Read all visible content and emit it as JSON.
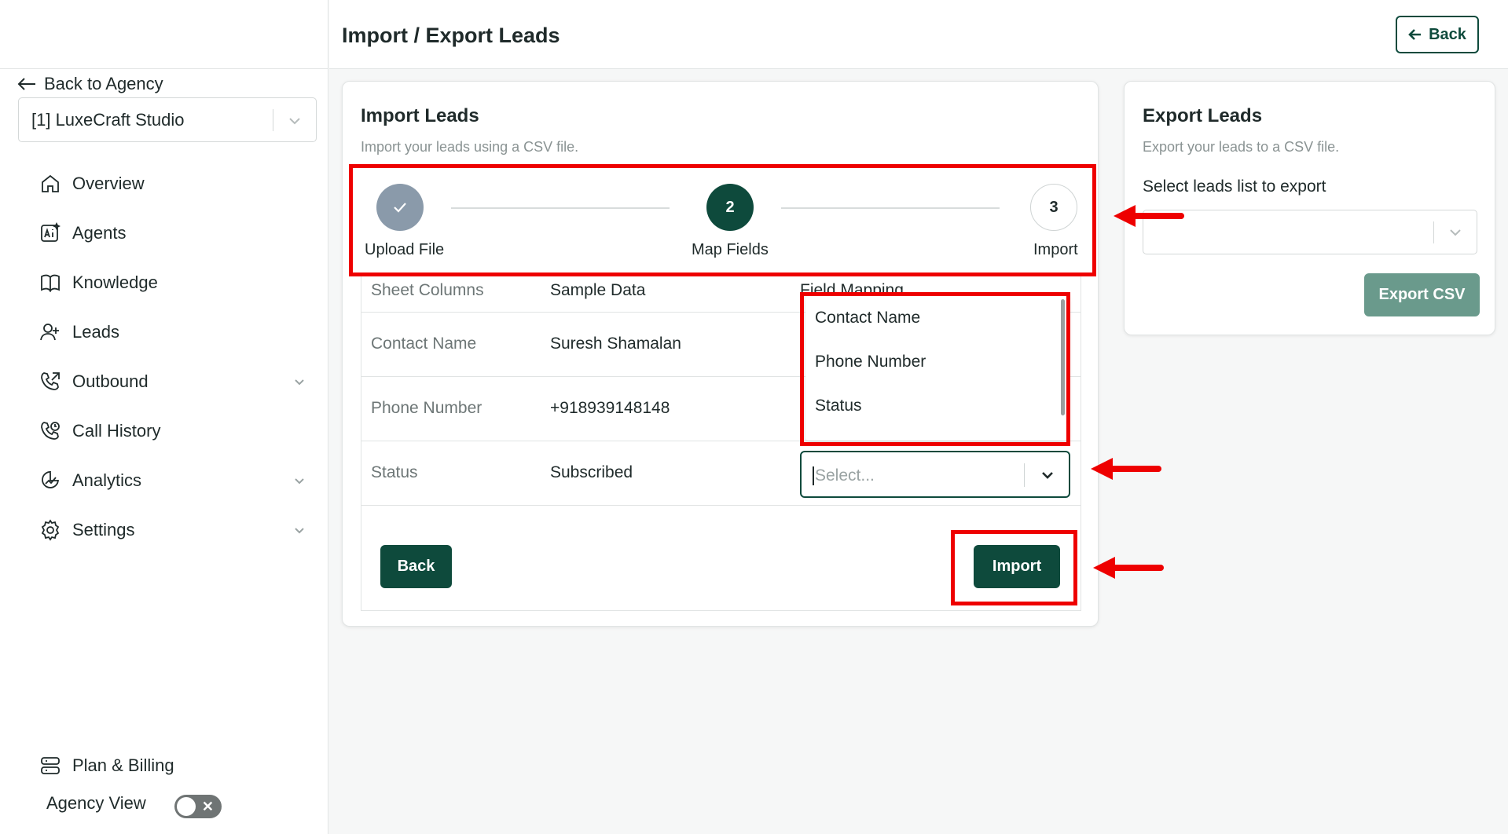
{
  "sidebar": {
    "back_label": "Back to Agency",
    "agency_selected": "[1] LuxeCraft Studio",
    "items": [
      {
        "label": "Overview",
        "icon": "home-icon"
      },
      {
        "label": "Agents",
        "icon": "ai-agent-icon"
      },
      {
        "label": "Knowledge",
        "icon": "book-icon"
      },
      {
        "label": "Leads",
        "icon": "user-plus-icon"
      },
      {
        "label": "Outbound",
        "icon": "phone-outgoing-icon"
      },
      {
        "label": "Call History",
        "icon": "phone-history-icon"
      },
      {
        "label": "Analytics",
        "icon": "analytics-icon"
      },
      {
        "label": "Settings",
        "icon": "gear-icon"
      }
    ],
    "plan_label": "Plan & Billing",
    "agency_view_label": "Agency View"
  },
  "header": {
    "title": "Import / Export Leads",
    "back_label": "Back"
  },
  "import_card": {
    "title": "Import Leads",
    "subtitle": "Import your leads using a CSV file.",
    "steps": [
      {
        "number": "",
        "label": "Upload File",
        "state": "done"
      },
      {
        "number": "2",
        "label": "Map Fields",
        "state": "active"
      },
      {
        "number": "3",
        "label": "Import",
        "state": "todo"
      }
    ],
    "table": {
      "headers": [
        "Sheet Columns",
        "Sample Data",
        "Field Mapping"
      ],
      "rows": [
        {
          "column": "Contact Name",
          "sample": "Suresh Shamalan"
        },
        {
          "column": "Phone Number",
          "sample": "+918939148148"
        },
        {
          "column": "Status",
          "sample": "Subscribed"
        }
      ]
    },
    "field_select_placeholder": "Select...",
    "dropdown_options": [
      "Contact Name",
      "Phone Number",
      "Status"
    ],
    "back_button": "Back",
    "import_button": "Import"
  },
  "export_card": {
    "title": "Export Leads",
    "subtitle": "Export your leads to a CSV file.",
    "select_label": "Select leads list to export",
    "export_button": "Export CSV"
  },
  "colors": {
    "brand": "#0e4a3c",
    "annotation": "#ee0000"
  }
}
